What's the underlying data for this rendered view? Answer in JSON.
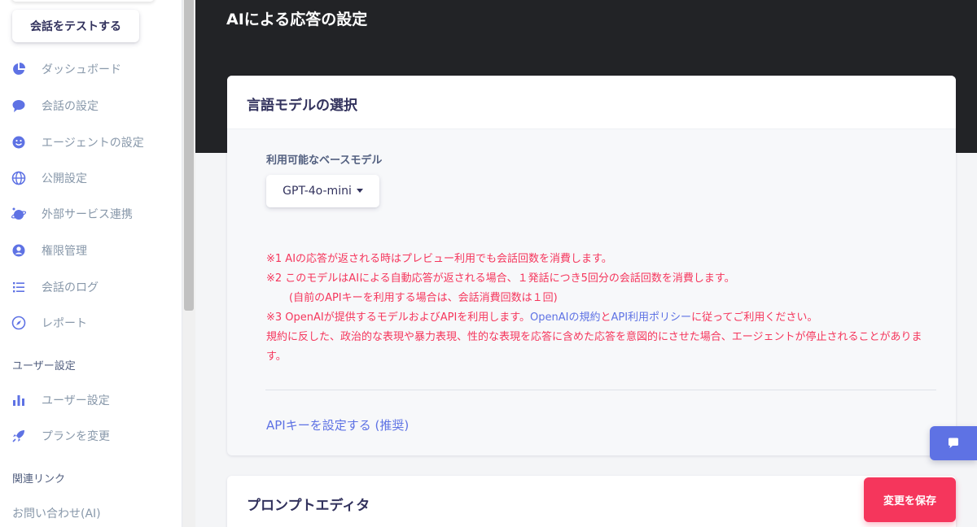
{
  "sidebar": {
    "test_button": "会話をテストする",
    "items": [
      {
        "label": "ダッシュボード",
        "icon": "pie-chart-icon"
      },
      {
        "label": "会話の設定",
        "icon": "chat-bubble-icon"
      },
      {
        "label": "エージェントの設定",
        "icon": "smiley-icon"
      },
      {
        "label": "公開設定",
        "icon": "globe-icon"
      },
      {
        "label": "外部サービス連携",
        "icon": "planet-icon"
      },
      {
        "label": "権限管理",
        "icon": "user-circle-icon"
      },
      {
        "label": "会話のログ",
        "icon": "list-icon"
      },
      {
        "label": "レポート",
        "icon": "compass-icon"
      }
    ],
    "user_section_title": "ユーザー設定",
    "user_items": [
      {
        "label": "ユーザー設定",
        "icon": "bar-chart-icon"
      },
      {
        "label": "プランを変更",
        "icon": "rocket-icon"
      }
    ],
    "links_section_title": "関連リンク",
    "contact_link": "お問い合わせ(AI)"
  },
  "page": {
    "title": "AIによる応答の設定"
  },
  "model_card": {
    "title": "言語モデルの選択",
    "field_label": "利用可能なベースモデル",
    "selected_model": "GPT-4o-mini",
    "notes": {
      "n1": "※1 AIの応答が返される時はプレビュー利用でも会話回数を消費します。",
      "n2": "※2 このモデルはAIによる自動応答が返される場合、１発話につき5回分の会話回数を消費します。",
      "n2b": "(自前のAPIキーを利用する場合は、会話消費回数は１回)",
      "n3_pre": "※3 OpenAIが提供するモデルおよびAPIを利用します。",
      "n3_link1": "OpenAIの規約",
      "n3_and": "と",
      "n3_link2": "API利用ポリシー",
      "n3_post": "に従ってご利用ください。",
      "n4": "規約に反した、政治的な表現や暴力表現、性的な表現を応答に含めた応答を意図的にさせた場合、エージェントが停止されることがあります。"
    },
    "api_key_link": "APIキーを設定する (推奨)"
  },
  "prompt_card": {
    "title": "プロンプトエディタ"
  },
  "save_button": "変更を保存",
  "colors": {
    "accent": "#5e72e4",
    "danger": "#f5365c",
    "header_bg": "#222326"
  }
}
